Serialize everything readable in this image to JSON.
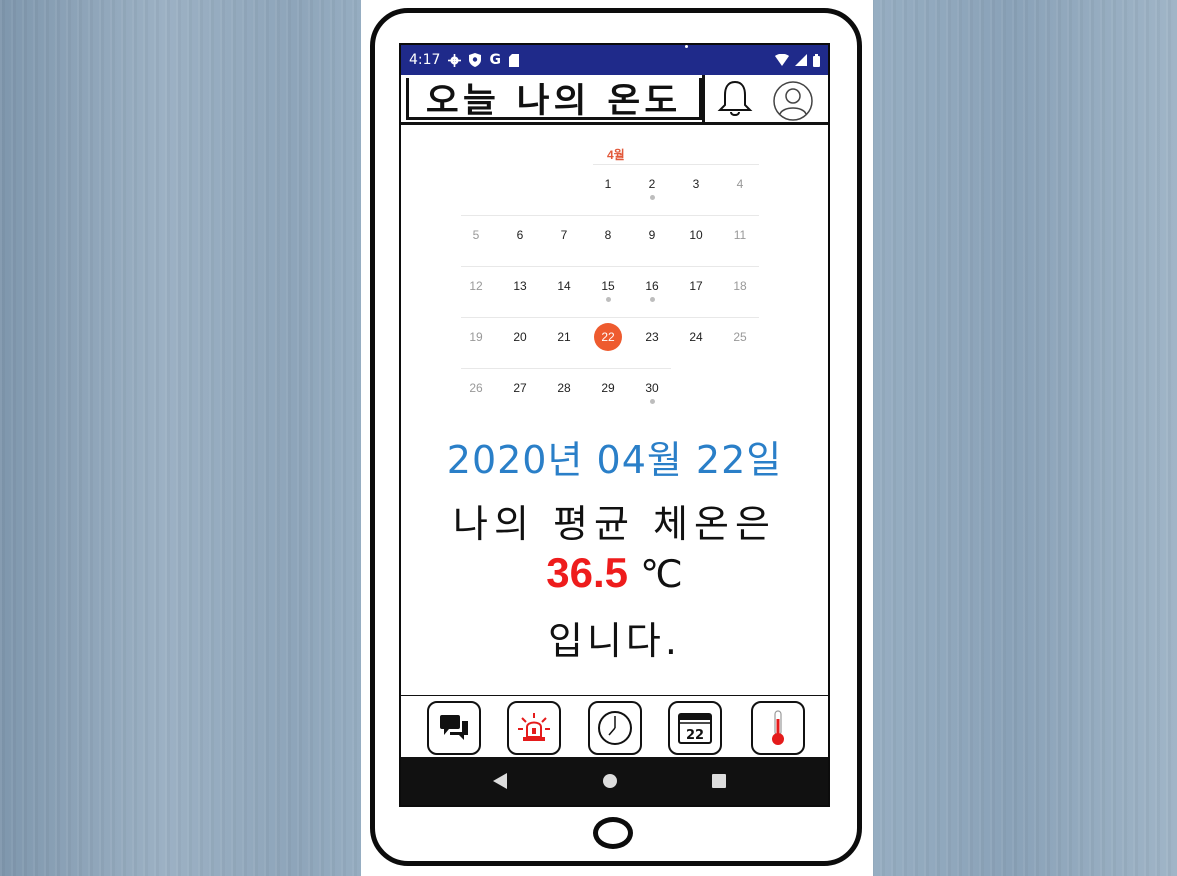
{
  "status_bar": {
    "time": "4:17",
    "icons": [
      "settings-icon",
      "shield-icon",
      "google-icon",
      "sd-card-icon",
      "wifi-icon",
      "signal-icon",
      "battery-icon"
    ]
  },
  "app_bar": {
    "title": "오늘 나의 온도",
    "icons": [
      "bell-icon",
      "profile-icon"
    ]
  },
  "calendar": {
    "month_label": "4월",
    "weeks": [
      [
        null,
        null,
        null,
        "1",
        "2",
        "3",
        "4"
      ],
      [
        "5",
        "6",
        "7",
        "8",
        "9",
        "10",
        "11"
      ],
      [
        "12",
        "13",
        "14",
        "15",
        "16",
        "17",
        "18"
      ],
      [
        "19",
        "20",
        "21",
        "22",
        "23",
        "24",
        "25"
      ],
      [
        "26",
        "27",
        "28",
        "29",
        "30",
        null,
        null
      ]
    ],
    "event_days": [
      "2",
      "15",
      "16",
      "30"
    ],
    "selected_day": "22",
    "accent_color": "#ee5b2f"
  },
  "info": {
    "date_text": "2020년 04월 22일",
    "line2": "나의 평균 체온은",
    "temp_value": "36.5",
    "temp_unit": "℃",
    "line4": "입니다.",
    "date_color": "#2a7fc8",
    "temp_color": "#ee1c1c"
  },
  "tab_bar": {
    "icons": [
      "chat-icon",
      "siren-icon",
      "clock-icon",
      "calendar-icon",
      "thermometer-icon"
    ],
    "calendar_tab_number": "22"
  },
  "nav_bar": {
    "icons": [
      "back-icon",
      "home-icon",
      "recents-icon"
    ]
  }
}
